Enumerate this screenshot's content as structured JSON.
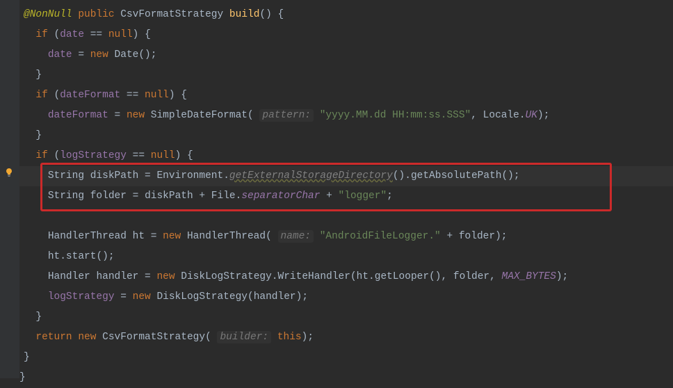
{
  "icons": {
    "bulb": "lightbulb-icon"
  },
  "line1": {
    "annotation": "@NonNull",
    "kw_public": "public",
    "type": "CsvFormatStrategy",
    "method": "build",
    "parens": "()",
    "brace": "{"
  },
  "line2": {
    "kw_if": "if",
    "open": "(",
    "field": "date",
    "eq": " == ",
    "kw_null": "null",
    "close": ")",
    "brace": "{"
  },
  "line3": {
    "field": "date",
    "eq": " = ",
    "kw_new": "new",
    "type": "Date",
    "parens": "()",
    "semi": ";"
  },
  "line4": {
    "brace": "}"
  },
  "line5": {
    "kw_if": "if",
    "open": "(",
    "field": "dateFormat",
    "eq": " == ",
    "kw_null": "null",
    "close": ")",
    "brace": "{"
  },
  "line6": {
    "field": "dateFormat",
    "eq": " = ",
    "kw_new": "new",
    "type": "SimpleDateFormat",
    "open": "(",
    "hint": "pattern:",
    "str": "\"yyyy.MM.dd HH:mm:ss.SSS\"",
    "comma": ",",
    "locale": "Locale",
    "dot": ".",
    "uk": "UK",
    "close": ")",
    "semi": ";"
  },
  "line7": {
    "brace": "}"
  },
  "line8": {
    "kw_if": "if",
    "open": "(",
    "field": "logStrategy",
    "eq": " == ",
    "kw_null": "null",
    "close": ")",
    "brace": "{"
  },
  "line9": {
    "type": "String",
    "var": "diskPath",
    "eq": " = ",
    "env": "Environment",
    "dot": ".",
    "deprecated": "getExternalStorageDirectory",
    "parens1": "()",
    "dot2": ".",
    "method": "getAbsolutePath",
    "parens2": "()",
    "semi": ";"
  },
  "line10": {
    "type": "String",
    "var": "folder",
    "eq": " = ",
    "var2": "diskPath",
    "plus": " + ",
    "file": "File",
    "dot": ".",
    "sepchar": "separatorChar",
    "plus2": " + ",
    "str": "\"logger\"",
    "semi": ";"
  },
  "line12": {
    "type": "HandlerThread",
    "var": "ht",
    "eq": " = ",
    "kw_new": "new",
    "type2": "HandlerThread",
    "open": "(",
    "hint": "name:",
    "str": "\"AndroidFileLogger.\"",
    "plus": " + ",
    "var2": "folder",
    "close": ")",
    "semi": ";"
  },
  "line13": {
    "var": "ht",
    "dot": ".",
    "method": "start",
    "parens": "()",
    "semi": ";"
  },
  "line14": {
    "type": "Handler",
    "var": "handler",
    "eq": " = ",
    "kw_new": "new",
    "type2": "DiskLogStrategy",
    "dot": ".",
    "type3": "WriteHandler",
    "open": "(",
    "var2": "ht",
    "dot2": ".",
    "method": "getLooper",
    "parens": "()",
    "comma": ",",
    "var3": "folder",
    "comma2": ",",
    "constant": "MAX_BYTES",
    "close": ")",
    "semi": ";"
  },
  "line15": {
    "field": "logStrategy",
    "eq": " = ",
    "kw_new": "new",
    "type": "DiskLogStrategy",
    "open": "(",
    "var": "handler",
    "close": ")",
    "semi": ";"
  },
  "line16": {
    "brace": "}"
  },
  "line17": {
    "kw_return": "return",
    "kw_new": "new",
    "type": "CsvFormatStrategy",
    "open": "(",
    "hint": "builder:",
    "kw_this": "this",
    "close": ")",
    "semi": ";"
  },
  "line18": {
    "brace": "}"
  },
  "line19": {
    "brace": "}"
  }
}
